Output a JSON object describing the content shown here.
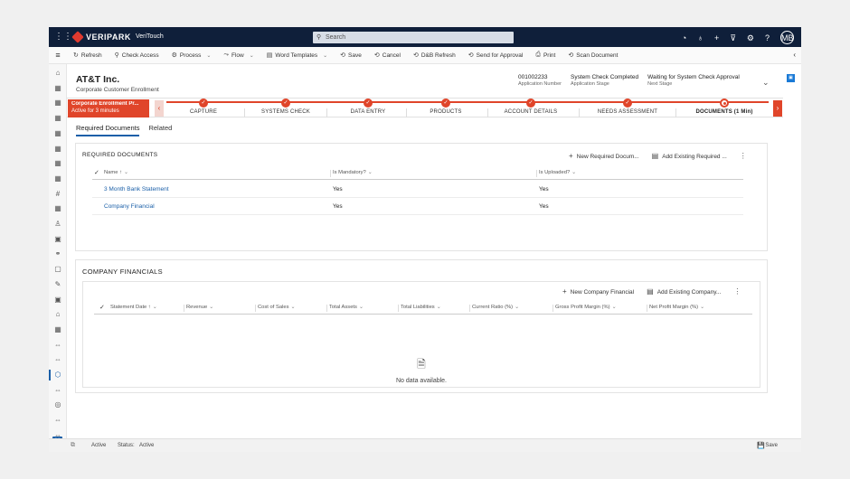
{
  "topbar": {
    "brand": "VERIPARK",
    "app_name": "VeriTouch",
    "search_placeholder": "Search",
    "avatar": "MB",
    "icons": [
      "waffle-icon",
      "assistant-icon",
      "lightbulb-icon",
      "plus-icon",
      "filter-icon",
      "settings-icon",
      "help-icon"
    ]
  },
  "commands": [
    {
      "label": "Refresh",
      "icon": "↻"
    },
    {
      "label": "Check Access",
      "icon": "⚲"
    },
    {
      "label": "Process",
      "icon": "⚙",
      "dropdown": true
    },
    {
      "label": "Flow",
      "icon": "⤳",
      "dropdown": true
    },
    {
      "label": "Word Templates",
      "icon": "▤",
      "dropdown": true
    },
    {
      "label": "Save",
      "icon": "⟲"
    },
    {
      "label": "Cancel",
      "icon": "⟲"
    },
    {
      "label": "D&B Refresh",
      "icon": "⟲"
    },
    {
      "label": "Send for Approval",
      "icon": "⟲"
    },
    {
      "label": "Print",
      "icon": "⎙"
    },
    {
      "label": "Scan Document",
      "icon": "⟲"
    }
  ],
  "record": {
    "title": "AT&T Inc.",
    "subtitle": "Corporate Customer Enrollment",
    "fields": [
      {
        "value": "001002233",
        "label": "Application Number"
      },
      {
        "value": "System Check Completed",
        "label": "Application Stage"
      },
      {
        "value": "Waiting for System Check Approval",
        "label": "Next Stage"
      }
    ]
  },
  "bpf": {
    "active_title": "Corporate Enrollment Pr...",
    "active_sub": "Active for 3 minutes",
    "stages": [
      {
        "label": "CAPTURE",
        "done": true
      },
      {
        "label": "SYSTEMS CHECK",
        "done": true
      },
      {
        "label": "DATA ENTRY",
        "done": true
      },
      {
        "label": "PRODUCTS",
        "done": true
      },
      {
        "label": "ACCOUNT DETAILS",
        "done": true
      },
      {
        "label": "NEEDS ASSESSMENT",
        "done": true
      },
      {
        "label": "DOCUMENTS  (1 Min)",
        "done": false,
        "current": true
      }
    ],
    "accent": "#e0452a"
  },
  "tabs": [
    {
      "label": "Required Documents",
      "active": true
    },
    {
      "label": "Related",
      "active": false
    }
  ],
  "required_documents": {
    "title": "REQUIRED DOCUMENTS",
    "actions": [
      "New Required Docum...",
      "Add Existing Required ..."
    ],
    "columns": [
      "Name ↑",
      "Is Mandatory?",
      "Is Uploaded?"
    ],
    "rows": [
      [
        "3 Month Bank Statement",
        "Yes",
        "Yes"
      ],
      [
        "Company Financial",
        "Yes",
        "Yes"
      ]
    ]
  },
  "company_financials": {
    "title": "COMPANY FINANCIALS",
    "actions": [
      "New Company Financial",
      "Add Existing Company..."
    ],
    "columns": [
      "Statement Date ↑",
      "Revenue",
      "Cost of Sales",
      "Total Assets",
      "Total Liabilities",
      "Current Ratio (%)",
      "Gross Profit Margin (%)",
      "Net Profit Margin (%)"
    ],
    "empty_text": "No data available."
  },
  "status": {
    "state": "Active",
    "status_label": "Status:",
    "status_value": "Active",
    "save": "Save"
  },
  "leftnav": {
    "badge": "V"
  }
}
